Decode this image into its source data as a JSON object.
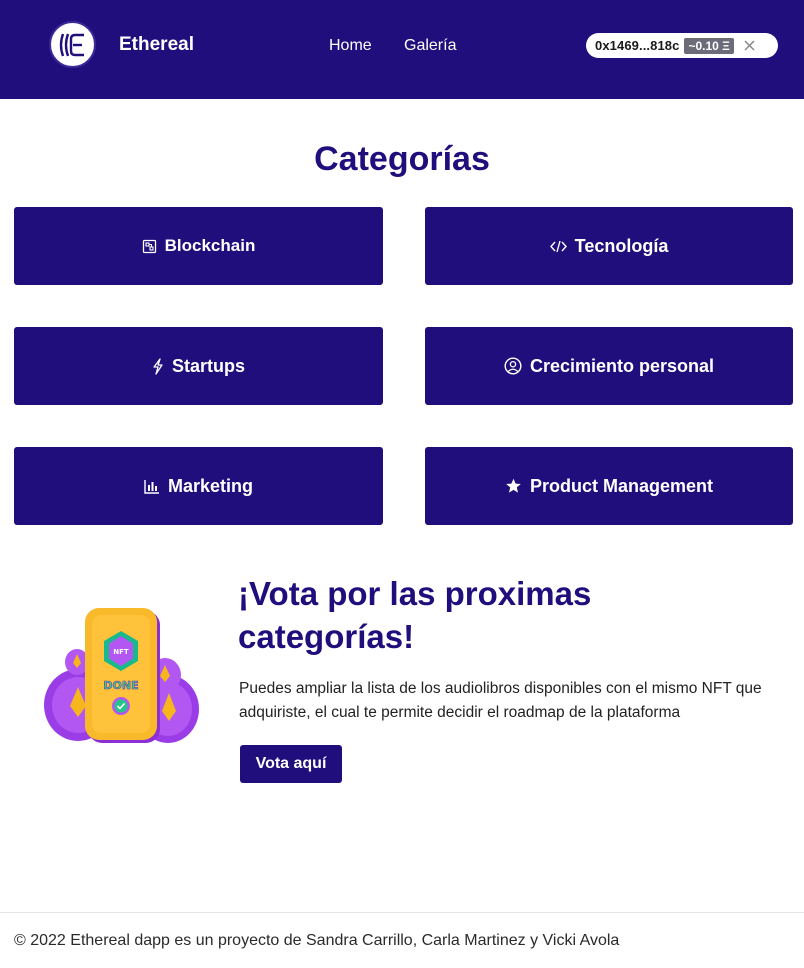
{
  "header": {
    "brand": "Ethereal",
    "nav": {
      "home": "Home",
      "gallery": "Galería"
    },
    "wallet": {
      "address": "0x1469...818c",
      "balance": "~0.10 Ξ"
    },
    "colors": {
      "background": "#210e7d",
      "text": "#ffffff"
    }
  },
  "categories": {
    "title": "Categorías",
    "items": [
      {
        "label": "Blockchain",
        "icon": "blockchain-icon"
      },
      {
        "label": "Tecnología",
        "icon": "code-icon"
      },
      {
        "label": "Startups",
        "icon": "lightning-icon"
      },
      {
        "label": "Crecimiento personal",
        "icon": "user-circle-icon"
      },
      {
        "label": "Marketing",
        "icon": "bar-chart-icon"
      },
      {
        "label": "Product Management",
        "icon": "star-icon"
      }
    ]
  },
  "vote": {
    "title": "¡Vota por las proximas categorías!",
    "description": "Puedes ampliar la lista de los audiolibros disponibles con el mismo NFT que adquiriste, el cual te permite decidir el roadmap de la plataforma",
    "button": "Vota aquí",
    "illustration": {
      "badge": "NFT",
      "label": "DONE"
    }
  },
  "footer": {
    "text": "© 2022 Ethereal dapp es un proyecto de Sandra Carrillo, Carla Martinez y Vicki Avola"
  }
}
